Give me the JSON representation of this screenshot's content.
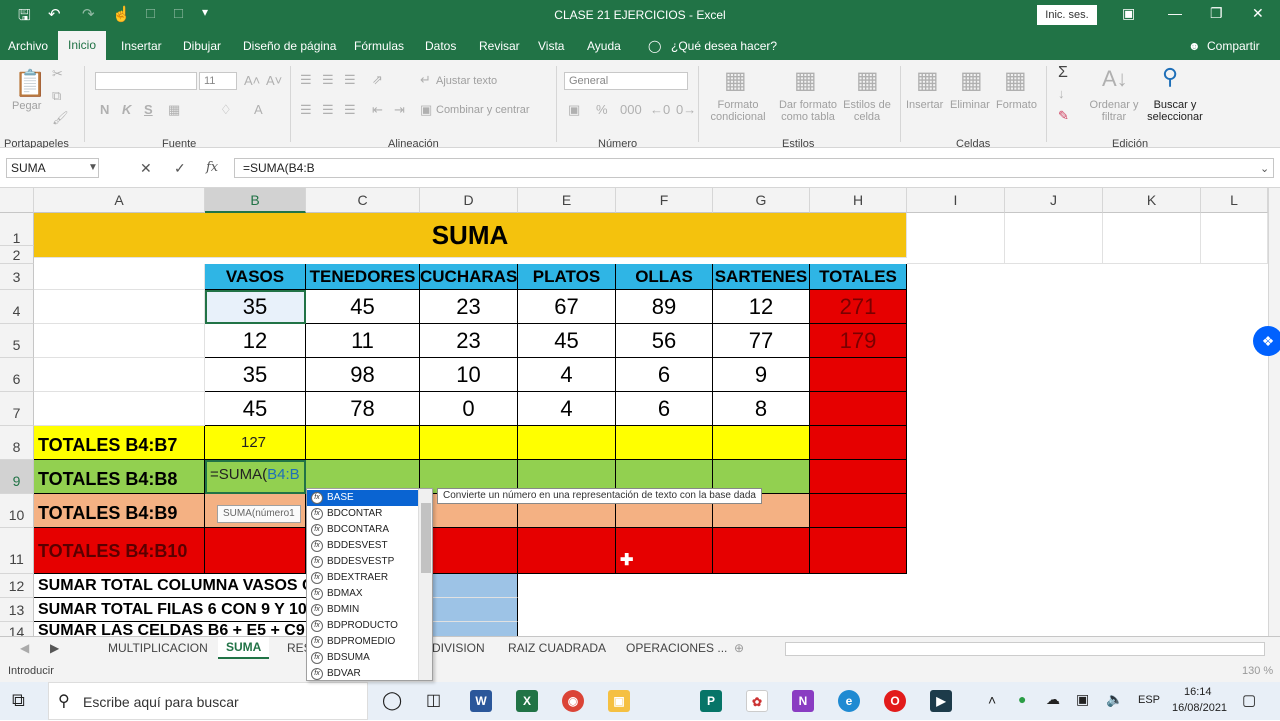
{
  "window": {
    "title": "CLASE 21 EJERCICIOS  -  Excel",
    "sign_in": "Inic. ses.",
    "share": "Compartir"
  },
  "menu": {
    "items": [
      "Archivo",
      "Inicio",
      "Insertar",
      "Dibujar",
      "Diseño de página",
      "Fórmulas",
      "Datos",
      "Revisar",
      "Vista",
      "Ayuda",
      "¿Qué desea hacer?"
    ]
  },
  "ribbon": {
    "paste": "Pegar",
    "font_size": "11",
    "bold": "N",
    "italic": "K",
    "underline": "S",
    "wrap_text": "Ajustar texto",
    "merge_center": "Combinar y centrar",
    "number_format": "General",
    "conditional_format": "Formato condicional",
    "table_format": "Dar formato como tabla",
    "cell_styles": "Estilos de celda",
    "insert": "Insertar",
    "delete": "Eliminar",
    "format": "Formato",
    "sort_filter": "Ordenar y filtrar",
    "find_select": "Buscar y seleccionar",
    "groups": [
      "Portapapeles",
      "Fuente",
      "Alineación",
      "Número",
      "Estilos",
      "Celdas",
      "Edición"
    ]
  },
  "formula_bar": {
    "name_box": "SUMA",
    "fx_label": "fx",
    "formula": "=SUMA(B4:B"
  },
  "columns": [
    "A",
    "B",
    "C",
    "D",
    "E",
    "F",
    "G",
    "H",
    "I",
    "J",
    "K",
    "L"
  ],
  "rows": [
    "1",
    "2",
    "3",
    "4",
    "5",
    "6",
    "7",
    "8",
    "9",
    "10",
    "11",
    "12",
    "13",
    "14"
  ],
  "sheet": {
    "title": "SUMA",
    "headers": [
      "VASOS",
      "TENEDORES",
      "CUCHARAS",
      "PLATOS",
      "OLLAS",
      "SARTENES",
      "TOTALES"
    ],
    "data": [
      [
        "35",
        "45",
        "23",
        "67",
        "89",
        "12",
        "271"
      ],
      [
        "12",
        "11",
        "23",
        "45",
        "56",
        "77",
        "179"
      ],
      [
        "35",
        "98",
        "10",
        "4",
        "6",
        "9",
        ""
      ],
      [
        "45",
        "78",
        "0",
        "4",
        "6",
        "8",
        ""
      ]
    ],
    "labels": {
      "r8": "TOTALES B4:B7",
      "r9": "TOTALES B4:B8",
      "r10": "TOTALES B4:B9",
      "r11": "TOTALES B4:B10",
      "r12": "SUMAR TOTAL COLUMNA VASOS CO",
      "r13": "SUMAR TOTAL FILAS 6 CON 9 Y 10",
      "r14": "SUMAR LAS CELDAS B6 + E5 + C9 + F"
    },
    "b8_value": "127",
    "b9_edit_prefix": "=SUMA(",
    "b9_edit_ref": "B4:B"
  },
  "autocomplete": {
    "items": [
      "BASE",
      "BDCONTAR",
      "BDCONTARA",
      "BDDESVEST",
      "BDDESVESTP",
      "BDEXTRAER",
      "BDMAX",
      "BDMIN",
      "BDPRODUCTO",
      "BDPROMEDIO",
      "BDSUMA",
      "BDVAR"
    ],
    "tooltip": "Convierte un número en una representación de texto con la base dada",
    "arg_hint": "SUMA(número1"
  },
  "sheet_tabs": [
    "MULTIPLICACION",
    "SUMA",
    "RES",
    "DIVISION",
    "RAIZ CUADRADA",
    "OPERACIONES ..."
  ],
  "status": {
    "mode": "Introducir",
    "zoom": "130 %"
  },
  "taskbar": {
    "search_placeholder": "Escribe aquí para buscar",
    "lang": "ESP",
    "time": "16:14",
    "date": "16/08/2021"
  },
  "colors": {
    "excel_green": "#217346",
    "title_fill": "#f4c20d",
    "header_fill": "#2fb5e5",
    "totals_fill": "#e60000",
    "yellow_fill": "#ffff00",
    "green_fill": "#92d050",
    "salmon_fill": "#f4b183",
    "blue_fill": "#9dc3e6"
  }
}
